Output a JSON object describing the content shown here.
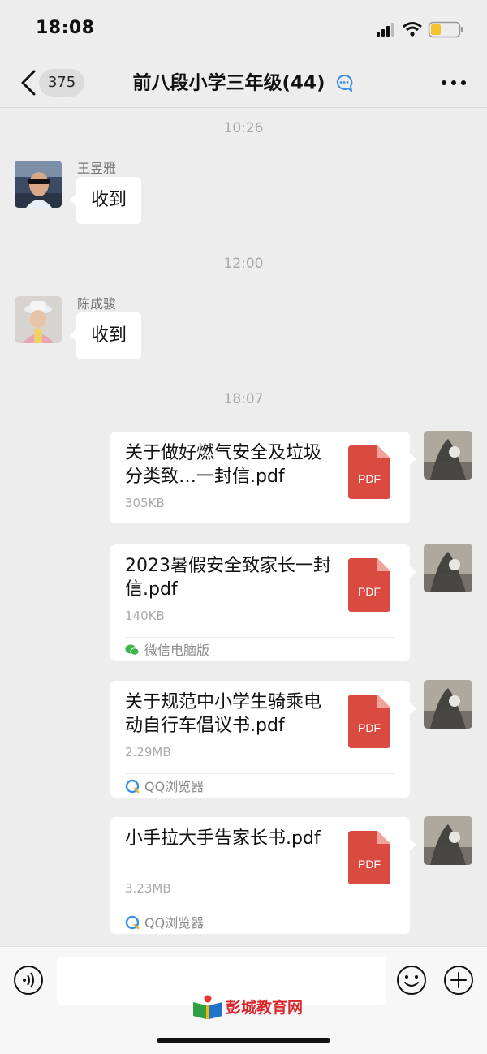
{
  "status_bar": {
    "time": "18:08"
  },
  "header": {
    "unread_count": "375",
    "title": "前八段小学三年级(44)"
  },
  "messages": {
    "ts1": "10:26",
    "msg1": {
      "sender": "王昱雅",
      "text": "收到"
    },
    "ts2": "12:00",
    "msg2": {
      "sender": "陈成骏",
      "text": "收到"
    },
    "ts3": "18:07"
  },
  "files": [
    {
      "name": "关于做好燃气安全及垃圾分类致…一封信.pdf",
      "size": "305KB",
      "icon": "PDF",
      "source": ""
    },
    {
      "name": "2023暑假安全致家长一封信.pdf",
      "size": "140KB",
      "icon": "PDF",
      "source": "微信电脑版"
    },
    {
      "name": "关于规范中小学生骑乘电动自行车倡议书.pdf",
      "size": "2.29MB",
      "icon": "PDF",
      "source": "QQ浏览器"
    },
    {
      "name": "小手拉大手告家长书.pdf",
      "size": "3.23MB",
      "icon": "PDF",
      "source": "QQ浏览器"
    }
  ],
  "input": {
    "placeholder": ""
  },
  "watermark": "彭城教育网",
  "colors": {
    "pdf_red": "#d94a40",
    "background": "#ededed",
    "wechat_green": "#3bb54a",
    "qq_blue": "#3a8ee6"
  }
}
